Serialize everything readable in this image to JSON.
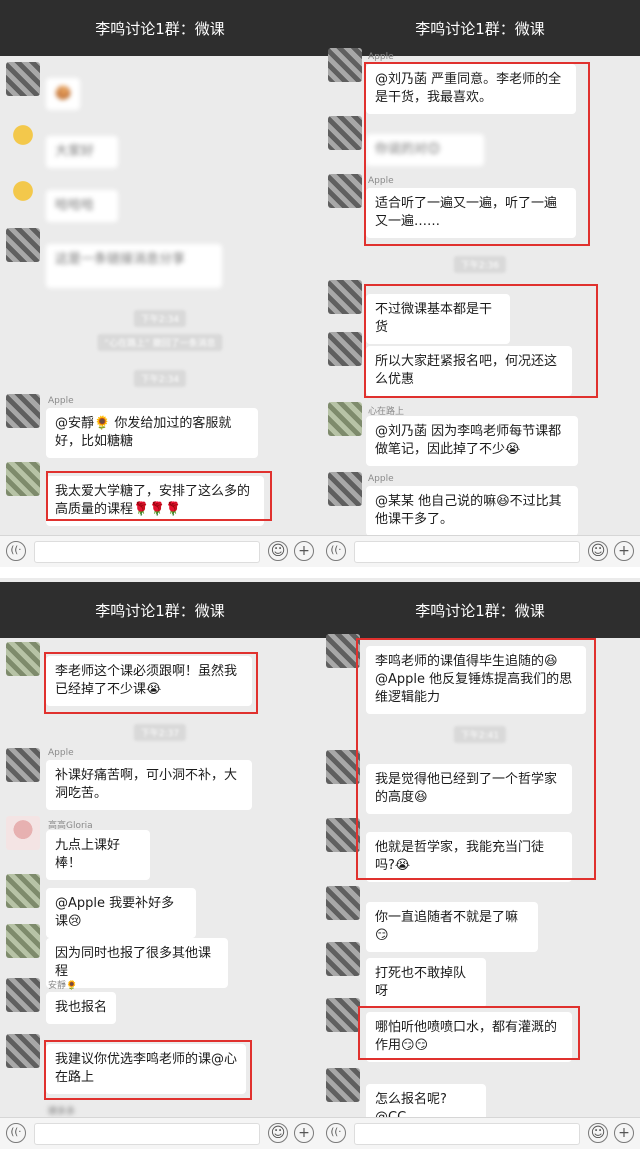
{
  "chat_title": "李鸣讨论1群：微课",
  "panel_tl": {
    "sender_apple": "Apple",
    "msg_apple": "@安靜🌻 你发给加过的客服就好，比如糖糖",
    "msg_self": "我太爱大学糖了，安排了这么多的高质量的课程🌹🌹🌹",
    "blur_1": "🍪",
    "blur_2": "大家好",
    "blur_3": "哈哈哈",
    "blur_4": "这是一条链接消息分享",
    "recall": "“心在路上” 撤回了一条消息",
    "ts1": "下午2:34",
    "ts2": "下午2:34"
  },
  "panel_tr": {
    "sender_apple1": "Apple",
    "msg1": "@刘乃菡 严重同意。李老师的全是干货，我最喜欢。",
    "blur_msg": "你说的对😊",
    "sender_apple2": "Apple",
    "msg2": "适合听了一遍又一遍，听了一遍又一遍……",
    "ts": "下午2:36",
    "msg3": "不过微课基本都是干货",
    "msg4": "所以大家赶紧报名吧，何况还这么优惠",
    "sender_xzls": "心在路上",
    "msg5": "@刘乃菡 因为李鸣老师每节课都做笔记，因此掉了不少😭",
    "sender_apple3": "Apple",
    "msg6": "@某某 他自己说的嘛😆不过比其他课干多了。"
  },
  "panel_bl": {
    "msg1": "李老师这个课必须跟啊！虽然我已经掉了不少课😭",
    "ts": "下午2:37",
    "sender_apple": "Apple",
    "msg2": "补课好痛苦啊，可小洞不补，大洞吃苦。",
    "sender_gloria": "高高Gloria",
    "msg3": "九点上课好棒！",
    "msg4": "@Apple 我要补好多课😢",
    "msg5": "因为同时也报了很多其他课程",
    "sender_anjing": "安靜🌻",
    "msg6": "我也报名",
    "msg7": "我建议你优选李鸣老师的课@心在路上",
    "sender_bottom": "德多多"
  },
  "panel_br": {
    "msg1": "李鸣老师的课值得毕生追随的😆\n@Apple 他反复锤炼提高我们的思维逻辑能力",
    "ts": "下午2:41",
    "msg2": "我是觉得他已经到了一个哲学家的高度😆",
    "msg3": "他就是哲学家，我能充当门徒吗?😭",
    "msg4": "你一直追随者不就是了嘛😏",
    "msg5": "打死也不敢掉队呀",
    "msg6": "哪怕听他喷喷口水，都有灌溉的作用😏😏",
    "msg7": "怎么报名呢? @CC"
  },
  "input_icons": {
    "voice": "((·",
    "emoji": "☺",
    "plus": "+"
  },
  "colors": {
    "header": "#2e2e2e",
    "bg": "#ebebeb",
    "highlight": "#e0312e"
  }
}
